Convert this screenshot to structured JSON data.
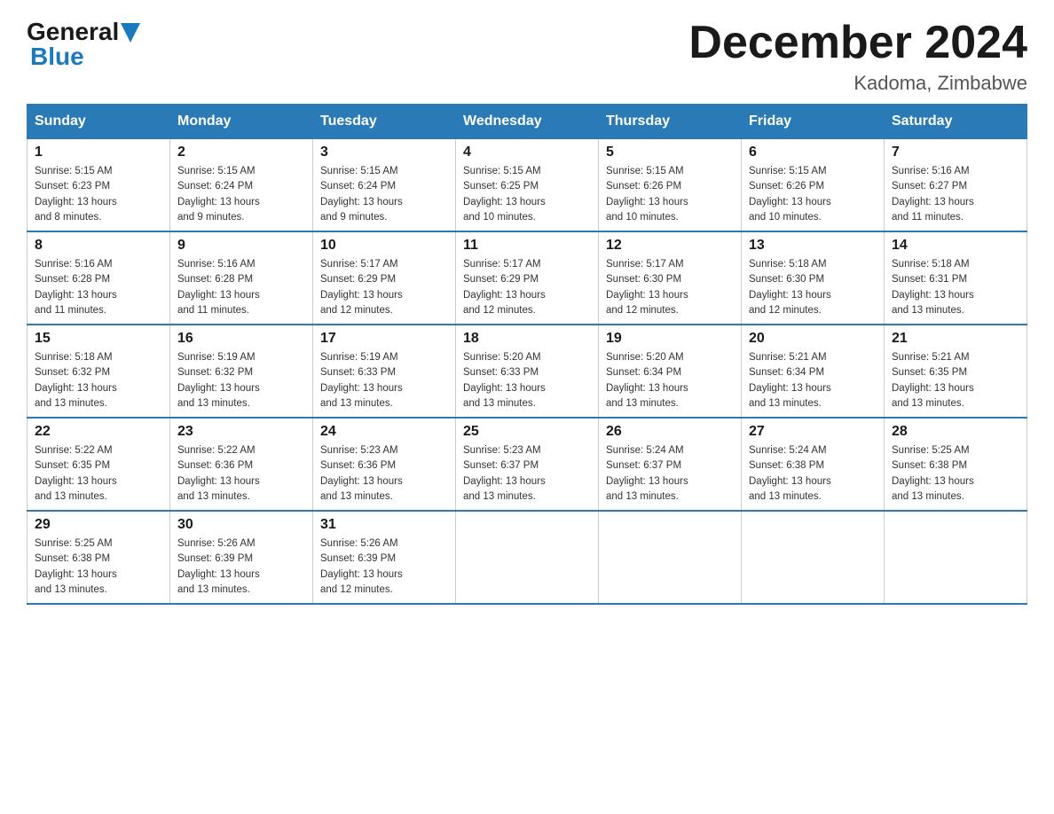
{
  "logo": {
    "general": "General",
    "blue": "Blue",
    "triangle": "▶"
  },
  "header": {
    "title": "December 2024",
    "subtitle": "Kadoma, Zimbabwe"
  },
  "days_of_week": [
    "Sunday",
    "Monday",
    "Tuesday",
    "Wednesday",
    "Thursday",
    "Friday",
    "Saturday"
  ],
  "weeks": [
    [
      {
        "day": "1",
        "sunrise": "5:15 AM",
        "sunset": "6:23 PM",
        "daylight": "13 hours and 8 minutes."
      },
      {
        "day": "2",
        "sunrise": "5:15 AM",
        "sunset": "6:24 PM",
        "daylight": "13 hours and 9 minutes."
      },
      {
        "day": "3",
        "sunrise": "5:15 AM",
        "sunset": "6:24 PM",
        "daylight": "13 hours and 9 minutes."
      },
      {
        "day": "4",
        "sunrise": "5:15 AM",
        "sunset": "6:25 PM",
        "daylight": "13 hours and 10 minutes."
      },
      {
        "day": "5",
        "sunrise": "5:15 AM",
        "sunset": "6:26 PM",
        "daylight": "13 hours and 10 minutes."
      },
      {
        "day": "6",
        "sunrise": "5:15 AM",
        "sunset": "6:26 PM",
        "daylight": "13 hours and 10 minutes."
      },
      {
        "day": "7",
        "sunrise": "5:16 AM",
        "sunset": "6:27 PM",
        "daylight": "13 hours and 11 minutes."
      }
    ],
    [
      {
        "day": "8",
        "sunrise": "5:16 AM",
        "sunset": "6:28 PM",
        "daylight": "13 hours and 11 minutes."
      },
      {
        "day": "9",
        "sunrise": "5:16 AM",
        "sunset": "6:28 PM",
        "daylight": "13 hours and 11 minutes."
      },
      {
        "day": "10",
        "sunrise": "5:17 AM",
        "sunset": "6:29 PM",
        "daylight": "13 hours and 12 minutes."
      },
      {
        "day": "11",
        "sunrise": "5:17 AM",
        "sunset": "6:29 PM",
        "daylight": "13 hours and 12 minutes."
      },
      {
        "day": "12",
        "sunrise": "5:17 AM",
        "sunset": "6:30 PM",
        "daylight": "13 hours and 12 minutes."
      },
      {
        "day": "13",
        "sunrise": "5:18 AM",
        "sunset": "6:30 PM",
        "daylight": "13 hours and 12 minutes."
      },
      {
        "day": "14",
        "sunrise": "5:18 AM",
        "sunset": "6:31 PM",
        "daylight": "13 hours and 13 minutes."
      }
    ],
    [
      {
        "day": "15",
        "sunrise": "5:18 AM",
        "sunset": "6:32 PM",
        "daylight": "13 hours and 13 minutes."
      },
      {
        "day": "16",
        "sunrise": "5:19 AM",
        "sunset": "6:32 PM",
        "daylight": "13 hours and 13 minutes."
      },
      {
        "day": "17",
        "sunrise": "5:19 AM",
        "sunset": "6:33 PM",
        "daylight": "13 hours and 13 minutes."
      },
      {
        "day": "18",
        "sunrise": "5:20 AM",
        "sunset": "6:33 PM",
        "daylight": "13 hours and 13 minutes."
      },
      {
        "day": "19",
        "sunrise": "5:20 AM",
        "sunset": "6:34 PM",
        "daylight": "13 hours and 13 minutes."
      },
      {
        "day": "20",
        "sunrise": "5:21 AM",
        "sunset": "6:34 PM",
        "daylight": "13 hours and 13 minutes."
      },
      {
        "day": "21",
        "sunrise": "5:21 AM",
        "sunset": "6:35 PM",
        "daylight": "13 hours and 13 minutes."
      }
    ],
    [
      {
        "day": "22",
        "sunrise": "5:22 AM",
        "sunset": "6:35 PM",
        "daylight": "13 hours and 13 minutes."
      },
      {
        "day": "23",
        "sunrise": "5:22 AM",
        "sunset": "6:36 PM",
        "daylight": "13 hours and 13 minutes."
      },
      {
        "day": "24",
        "sunrise": "5:23 AM",
        "sunset": "6:36 PM",
        "daylight": "13 hours and 13 minutes."
      },
      {
        "day": "25",
        "sunrise": "5:23 AM",
        "sunset": "6:37 PM",
        "daylight": "13 hours and 13 minutes."
      },
      {
        "day": "26",
        "sunrise": "5:24 AM",
        "sunset": "6:37 PM",
        "daylight": "13 hours and 13 minutes."
      },
      {
        "day": "27",
        "sunrise": "5:24 AM",
        "sunset": "6:38 PM",
        "daylight": "13 hours and 13 minutes."
      },
      {
        "day": "28",
        "sunrise": "5:25 AM",
        "sunset": "6:38 PM",
        "daylight": "13 hours and 13 minutes."
      }
    ],
    [
      {
        "day": "29",
        "sunrise": "5:25 AM",
        "sunset": "6:38 PM",
        "daylight": "13 hours and 13 minutes."
      },
      {
        "day": "30",
        "sunrise": "5:26 AM",
        "sunset": "6:39 PM",
        "daylight": "13 hours and 13 minutes."
      },
      {
        "day": "31",
        "sunrise": "5:26 AM",
        "sunset": "6:39 PM",
        "daylight": "13 hours and 12 minutes."
      },
      null,
      null,
      null,
      null
    ]
  ],
  "labels": {
    "sunrise": "Sunrise:",
    "sunset": "Sunset:",
    "daylight": "Daylight:"
  }
}
